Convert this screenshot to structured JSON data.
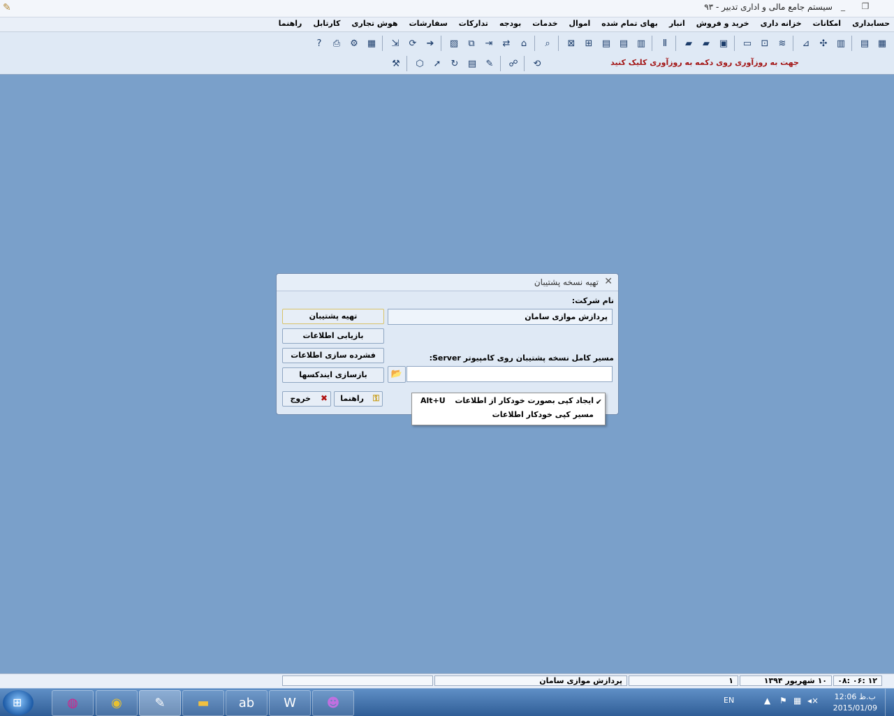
{
  "window": {
    "title": "سیستم جامع مالی و اداری تدبیر - ۹۳",
    "controls": [
      "_",
      "❐",
      "×"
    ]
  },
  "menu": [
    "حسابداری",
    "امکانات",
    "خزانه داری",
    "خرید و فروش",
    "انبار",
    "بهای تمام شده",
    "اموال",
    "خدمات",
    "بودجه",
    "تدارکات",
    "سفارشات",
    "هوش تجاری",
    "کارتابل",
    "راهنما"
  ],
  "toolbar": {
    "hint": "جهت به روزآوری روی دکمه به روزآوری کلیک کنید"
  },
  "dialog": {
    "title": "تهیه نسخه پشتیبان",
    "company_label": "نام شرکت:",
    "company_value": "پردازش موازی سامان",
    "path_label": "مسیر کامل نسخه پشتیبان روی کامپیوتر Server:",
    "path_value": "",
    "buttons": {
      "backup": "تهیه پشتیبان",
      "restore": "بازیابی اطلاعات",
      "compress": "فشرده سازی اطلاعات",
      "reindex": "بازسازی ایندکسها",
      "help": "راهنما",
      "exit": "خروج"
    }
  },
  "popup": {
    "item1": "ایجاد کپی بصورت خودکار از اطلاعات",
    "item1_shortcut": "Alt+U",
    "item1_checked": true,
    "item2": "مسیر کپی خودکار اطلاعات"
  },
  "status": {
    "time": "۱۲ :۰۶ :۰۸",
    "date": "۱۰ شهریور ۱۳۹۴",
    "number": "۱",
    "company": "پردازش موازی سامان",
    "empty": ""
  },
  "taskbar": {
    "lang": "EN",
    "time": "12:06 ب.ظ",
    "date": "2015/01/09"
  }
}
